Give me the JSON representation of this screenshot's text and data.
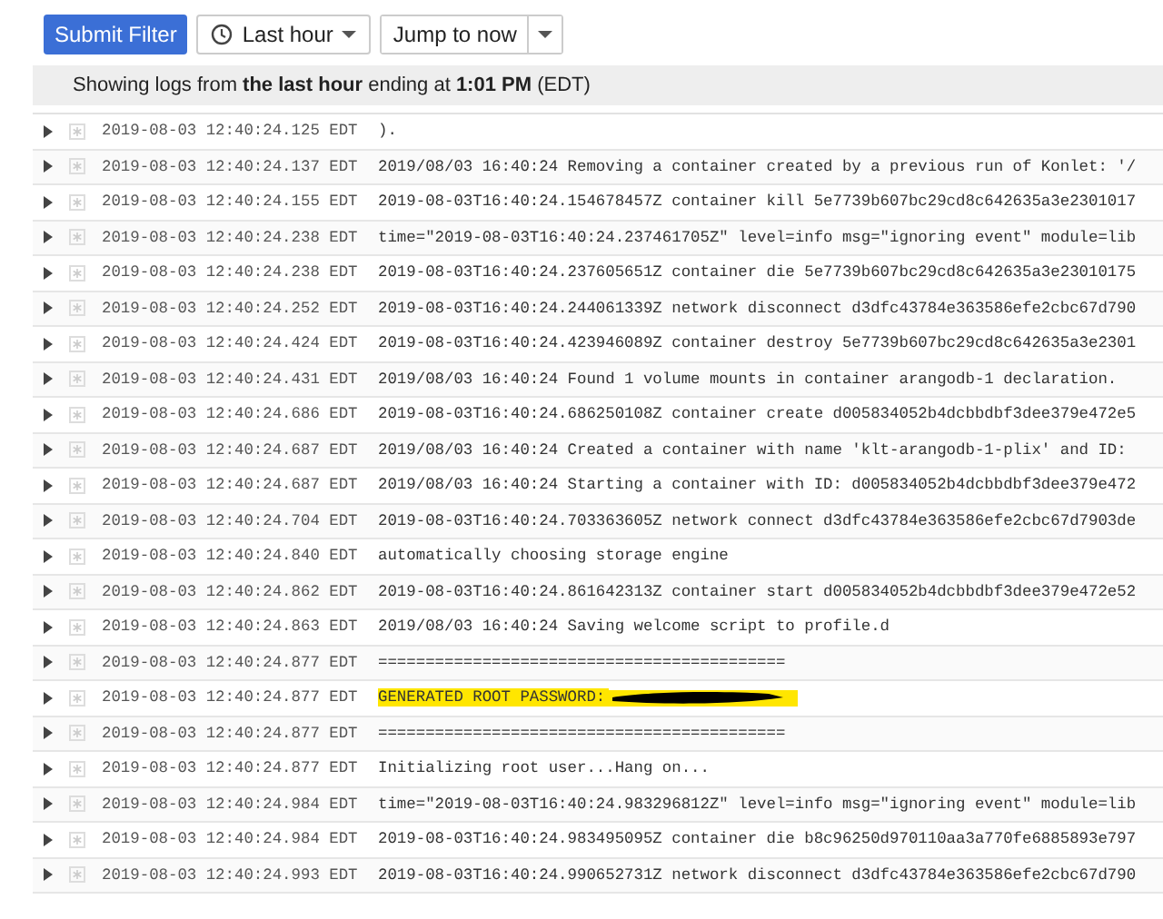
{
  "toolbar": {
    "submit": "Submit Filter",
    "range": "Last hour",
    "jump": "Jump to now"
  },
  "info": "Showing logs from **the last hour** ending at **1:01 PM** (EDT)",
  "rows": [
    {
      "time": "2019-08-03 12:40:24.125 EDT",
      "message": ").",
      "highlighted": false,
      "redacted": false
    },
    {
      "time": "2019-08-03 12:40:24.137 EDT",
      "message": "2019/08/03 16:40:24 Removing a container created by a previous run of Konlet: '/",
      "highlighted": false,
      "redacted": false
    },
    {
      "time": "2019-08-03 12:40:24.155 EDT",
      "message": "2019-08-03T16:40:24.154678457Z container kill 5e7739b607bc29cd8c642635a3e2301017",
      "highlighted": false,
      "redacted": false
    },
    {
      "time": "2019-08-03 12:40:24.238 EDT",
      "message": "time=\"2019-08-03T16:40:24.237461705Z\" level=info msg=\"ignoring event\" module=lib",
      "highlighted": false,
      "redacted": false
    },
    {
      "time": "2019-08-03 12:40:24.238 EDT",
      "message": "2019-08-03T16:40:24.237605651Z container die 5e7739b607bc29cd8c642635a3e23010175",
      "highlighted": false,
      "redacted": false
    },
    {
      "time": "2019-08-03 12:40:24.252 EDT",
      "message": "2019-08-03T16:40:24.244061339Z network disconnect d3dfc43784e363586efe2cbc67d790",
      "highlighted": false,
      "redacted": false
    },
    {
      "time": "2019-08-03 12:40:24.424 EDT",
      "message": "2019-08-03T16:40:24.423946089Z container destroy 5e7739b607bc29cd8c642635a3e2301",
      "highlighted": false,
      "redacted": false
    },
    {
      "time": "2019-08-03 12:40:24.431 EDT",
      "message": "2019/08/03 16:40:24 Found 1 volume mounts in container arangodb-1 declaration.",
      "highlighted": false,
      "redacted": false
    },
    {
      "time": "2019-08-03 12:40:24.686 EDT",
      "message": "2019-08-03T16:40:24.686250108Z container create d005834052b4dcbbdbf3dee379e472e5",
      "highlighted": false,
      "redacted": false
    },
    {
      "time": "2019-08-03 12:40:24.687 EDT",
      "message": "2019/08/03 16:40:24 Created a container with name 'klt-arangodb-1-plix' and ID:",
      "highlighted": false,
      "redacted": false
    },
    {
      "time": "2019-08-03 12:40:24.687 EDT",
      "message": "2019/08/03 16:40:24 Starting a container with ID: d005834052b4dcbbdbf3dee379e472",
      "highlighted": false,
      "redacted": false
    },
    {
      "time": "2019-08-03 12:40:24.704 EDT",
      "message": "2019-08-03T16:40:24.703363605Z network connect d3dfc43784e363586efe2cbc67d7903de",
      "highlighted": false,
      "redacted": false
    },
    {
      "time": "2019-08-03 12:40:24.840 EDT",
      "message": "automatically choosing storage engine",
      "highlighted": false,
      "redacted": false
    },
    {
      "time": "2019-08-03 12:40:24.862 EDT",
      "message": "2019-08-03T16:40:24.861642313Z container start d005834052b4dcbbdbf3dee379e472e52",
      "highlighted": false,
      "redacted": false
    },
    {
      "time": "2019-08-03 12:40:24.863 EDT",
      "message": "2019/08/03 16:40:24 Saving welcome script to profile.d",
      "highlighted": false,
      "redacted": false
    },
    {
      "time": "2019-08-03 12:40:24.877 EDT",
      "message": "===========================================",
      "highlighted": false,
      "redacted": false
    },
    {
      "time": "2019-08-03 12:40:24.877 EDT",
      "message": "GENERATED ROOT PASSWORD:",
      "highlighted": true,
      "redacted": true
    },
    {
      "time": "2019-08-03 12:40:24.877 EDT",
      "message": "===========================================",
      "highlighted": false,
      "redacted": false
    },
    {
      "time": "2019-08-03 12:40:24.877 EDT",
      "message": "Initializing root user...Hang on...",
      "highlighted": false,
      "redacted": false
    },
    {
      "time": "2019-08-03 12:40:24.984 EDT",
      "message": "time=\"2019-08-03T16:40:24.983296812Z\" level=info msg=\"ignoring event\" module=lib",
      "highlighted": false,
      "redacted": false
    },
    {
      "time": "2019-08-03 12:40:24.984 EDT",
      "message": "2019-08-03T16:40:24.983495095Z container die b8c96250d970110aa3a770fe6885893e797",
      "highlighted": false,
      "redacted": false
    },
    {
      "time": "2019-08-03 12:40:24.993 EDT",
      "message": "2019-08-03T16:40:24.990652731Z network disconnect d3dfc43784e363586efe2cbc67d790",
      "highlighted": false,
      "redacted": false
    }
  ]
}
